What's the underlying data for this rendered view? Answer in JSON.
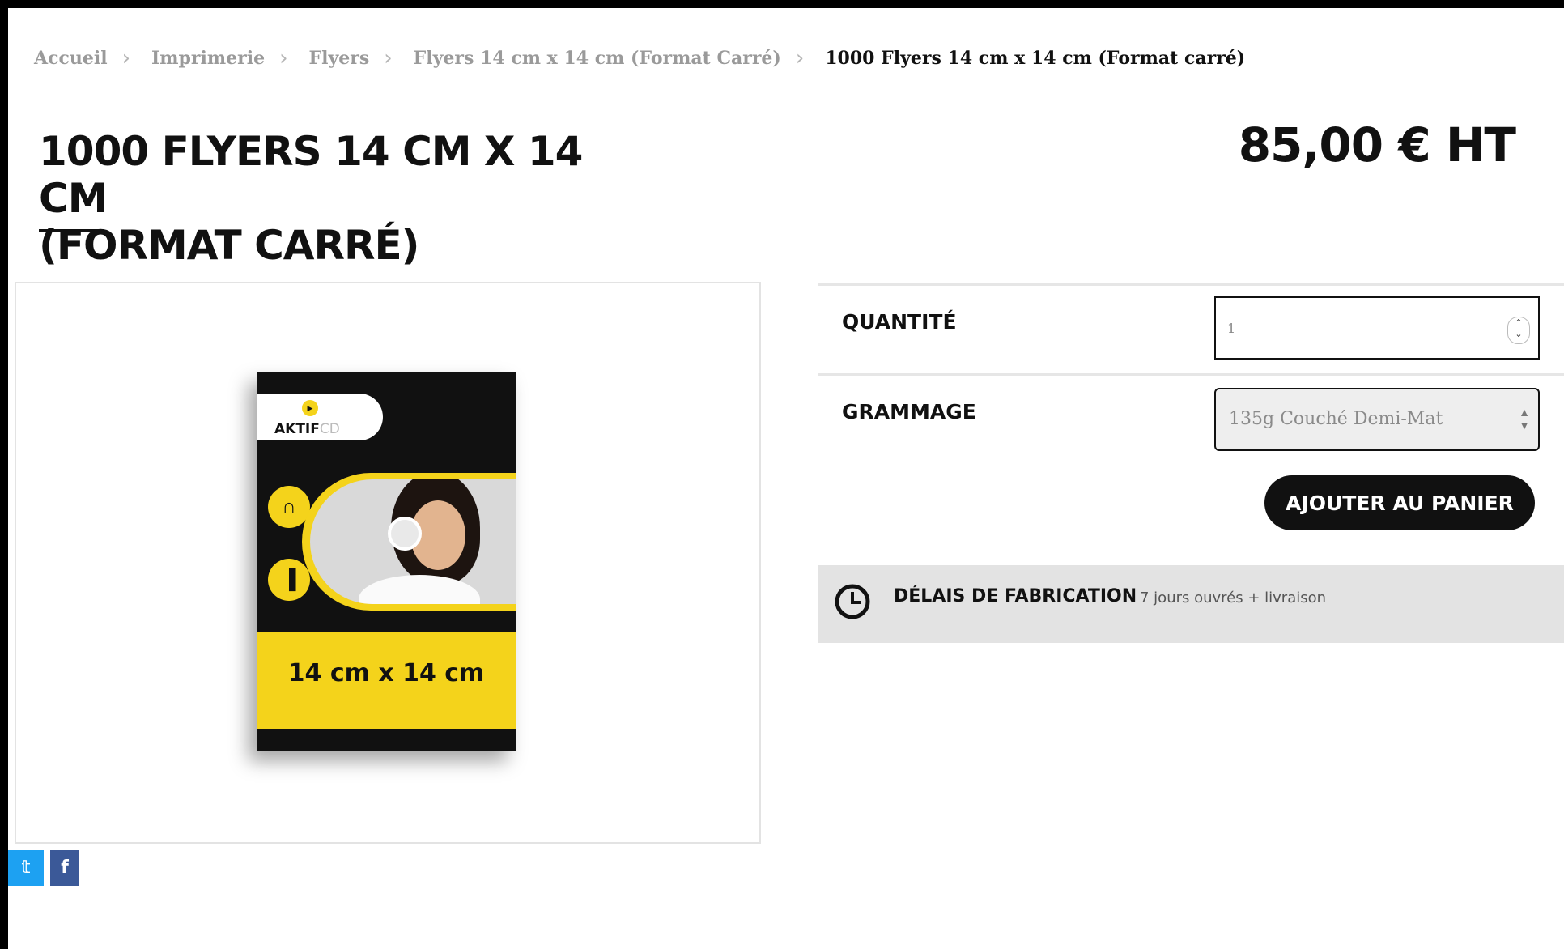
{
  "breadcrumb": {
    "items": [
      "Accueil",
      "Imprimerie",
      "Flyers",
      "Flyers 14 cm x 14 cm (Format Carré)"
    ],
    "current": "1000 Flyers 14 cm x 14 cm (Format carré)"
  },
  "product": {
    "title_line1": "1000 FLYERS 14 CM X 14 CM",
    "title_line2": "(FORMAT CARRÉ)",
    "price": "85,00 € HT"
  },
  "image": {
    "logo_bold": "AKTIF",
    "logo_light": "CD",
    "flyer_size": "14 cm x 14 cm"
  },
  "options": {
    "quantity_label": "QUANTITÉ",
    "quantity_value": "1",
    "grammage_label": "GRAMMAGE",
    "grammage_value": "135g Couché Demi-Mat",
    "add_to_cart": "AJOUTER AU PANIER"
  },
  "delivery": {
    "label": "DÉLAIS DE FABRICATION",
    "value": "7 jours ouvrés + livraison"
  },
  "social": {
    "twitter_icon": "twitter-icon",
    "facebook_icon": "facebook-icon"
  },
  "colors": {
    "accent_yellow": "#f4d31b",
    "twitter": "#1da1f2",
    "facebook": "#3b5998"
  }
}
